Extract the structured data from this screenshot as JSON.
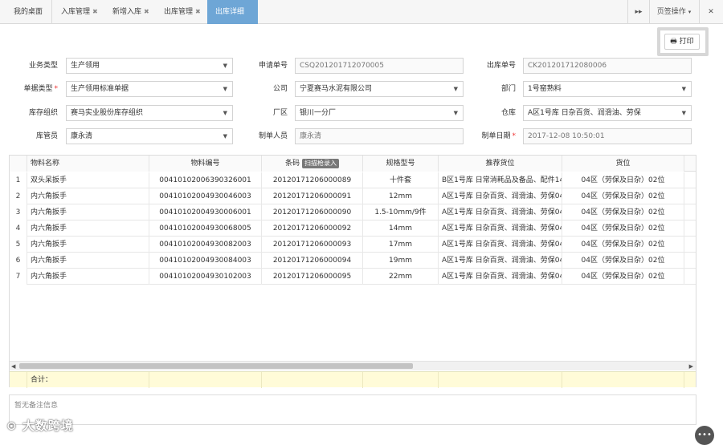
{
  "tabs": [
    {
      "label": "我的桌面",
      "closable": false
    },
    {
      "label": "入库管理",
      "closable": true
    },
    {
      "label": "新增入库",
      "closable": true
    },
    {
      "label": "出库管理",
      "closable": true
    },
    {
      "label": "出库详细",
      "closable": false,
      "active": true
    }
  ],
  "toolbar": {
    "scroll_right": "▸▸",
    "page_ops": "页签操作",
    "fullscreen": "✕"
  },
  "print_label": "打印",
  "form": {
    "biz_type": {
      "label": "业务类型",
      "value": "生产领用"
    },
    "apply_no": {
      "label": "申请单号",
      "value": "CSQ201201712070005"
    },
    "out_no": {
      "label": "出库单号",
      "value": "CK201201712080006"
    },
    "doc_type": {
      "label": "单据类型",
      "value": "生产领用标准单据"
    },
    "company": {
      "label": "公司",
      "value": "宁夏赛马水泥有限公司"
    },
    "dept": {
      "label": "部门",
      "value": "1号窑熟料"
    },
    "stock_org": {
      "label": "库存组织",
      "value": "赛马实业股份库存组织"
    },
    "plant": {
      "label": "厂区",
      "value": "银川一分厂"
    },
    "warehouse": {
      "label": "仓库",
      "value": "A区1号库 日杂百货、润滑油、劳保"
    },
    "keeper": {
      "label": "库管员",
      "value": "康永清"
    },
    "creator": {
      "label": "制单人员",
      "value": "康永清"
    },
    "create_date": {
      "label": "制单日期",
      "value": "2017-12-08 10:50:01"
    }
  },
  "grid": {
    "headers": {
      "name": "物料名称",
      "code": "物料编号",
      "barcode": "条码",
      "scan": "扫描枪录入",
      "spec": "规格型号",
      "rec_loc": "推荐货位",
      "loc": "货位"
    },
    "rows": [
      {
        "no": "1",
        "name": "双头呆扳手",
        "code": "00410102006390326001",
        "barcode": "20120171206000089",
        "spec": "十件套",
        "rec_loc": "B区1号库 日常消耗品及备品、配件14|",
        "loc": "04区（劳保及日杂）02位"
      },
      {
        "no": "2",
        "name": "内六角扳手",
        "code": "00410102004930046003",
        "barcode": "20120171206000091",
        "spec": "12mm",
        "rec_loc": "A区1号库 日杂百货、润滑油、劳保04|",
        "loc": "04区（劳保及日杂）02位"
      },
      {
        "no": "3",
        "name": "内六角扳手",
        "code": "00410102004930006001",
        "barcode": "20120171206000090",
        "spec": "1.5-10mm/9件",
        "rec_loc": "A区1号库 日杂百货、润滑油、劳保04|",
        "loc": "04区（劳保及日杂）02位"
      },
      {
        "no": "4",
        "name": "内六角扳手",
        "code": "00410102004930068005",
        "barcode": "20120171206000092",
        "spec": "14mm",
        "rec_loc": "A区1号库 日杂百货、润滑油、劳保04|",
        "loc": "04区（劳保及日杂）02位"
      },
      {
        "no": "5",
        "name": "内六角扳手",
        "code": "00410102004930082003",
        "barcode": "20120171206000093",
        "spec": "17mm",
        "rec_loc": "A区1号库 日杂百货、润滑油、劳保04|",
        "loc": "04区（劳保及日杂）02位"
      },
      {
        "no": "6",
        "name": "内六角扳手",
        "code": "00410102004930084003",
        "barcode": "20120171206000094",
        "spec": "19mm",
        "rec_loc": "A区1号库 日杂百货、润滑油、劳保04|",
        "loc": "04区（劳保及日杂）02位"
      },
      {
        "no": "7",
        "name": "内六角扳手",
        "code": "00410102004930102003",
        "barcode": "20120171206000095",
        "spec": "22mm",
        "rec_loc": "A区1号库 日杂百货、润滑油、劳保04|",
        "loc": "04区（劳保及日杂）02位"
      }
    ],
    "total_label": "合计："
  },
  "remark": "暂无备注信息",
  "watermark": "大数跨境",
  "colors": {
    "active_tab": "#6ea6d6",
    "sum_row": "#fffbd8",
    "required": "#e33333"
  }
}
